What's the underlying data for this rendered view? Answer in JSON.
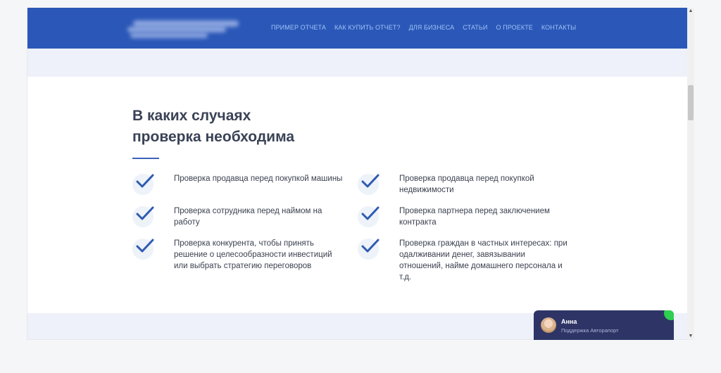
{
  "nav": {
    "items": [
      "ПРИМЕР ОТЧЕТА",
      "КАК КУПИТЬ ОТЧЕТ?",
      "ДЛЯ БИЗНЕСА",
      "СТАТЬИ",
      "О ПРОЕКТЕ",
      "КОНТАКТЫ"
    ]
  },
  "section": {
    "title_line1": "В каких случаях",
    "title_line2": "проверка необходима",
    "items": [
      "Проверка продавца перед покупкой машины",
      "Проверка продавца перед покупкой недвижимости",
      "Проверка сотрудника перед наймом на работу",
      "Проверка партнера перед заключением контракта",
      "Проверка конкурента, чтобы принять решение о целесообразности инвестиций или выбрать стратегию переговоров",
      "Проверка граждан в частных интересах: при одалживании денег, завязывании отношений, найме домашнего персонала и т.д."
    ]
  },
  "chat": {
    "name": "Анна",
    "role": "Поддержка Автоpaпорт"
  },
  "colors": {
    "header": "#2b58b8",
    "accent": "#3c63b8",
    "chat_bg": "#2e3566",
    "online": "#2fcf52"
  },
  "icons": [
    "check-icon",
    "avatar"
  ]
}
